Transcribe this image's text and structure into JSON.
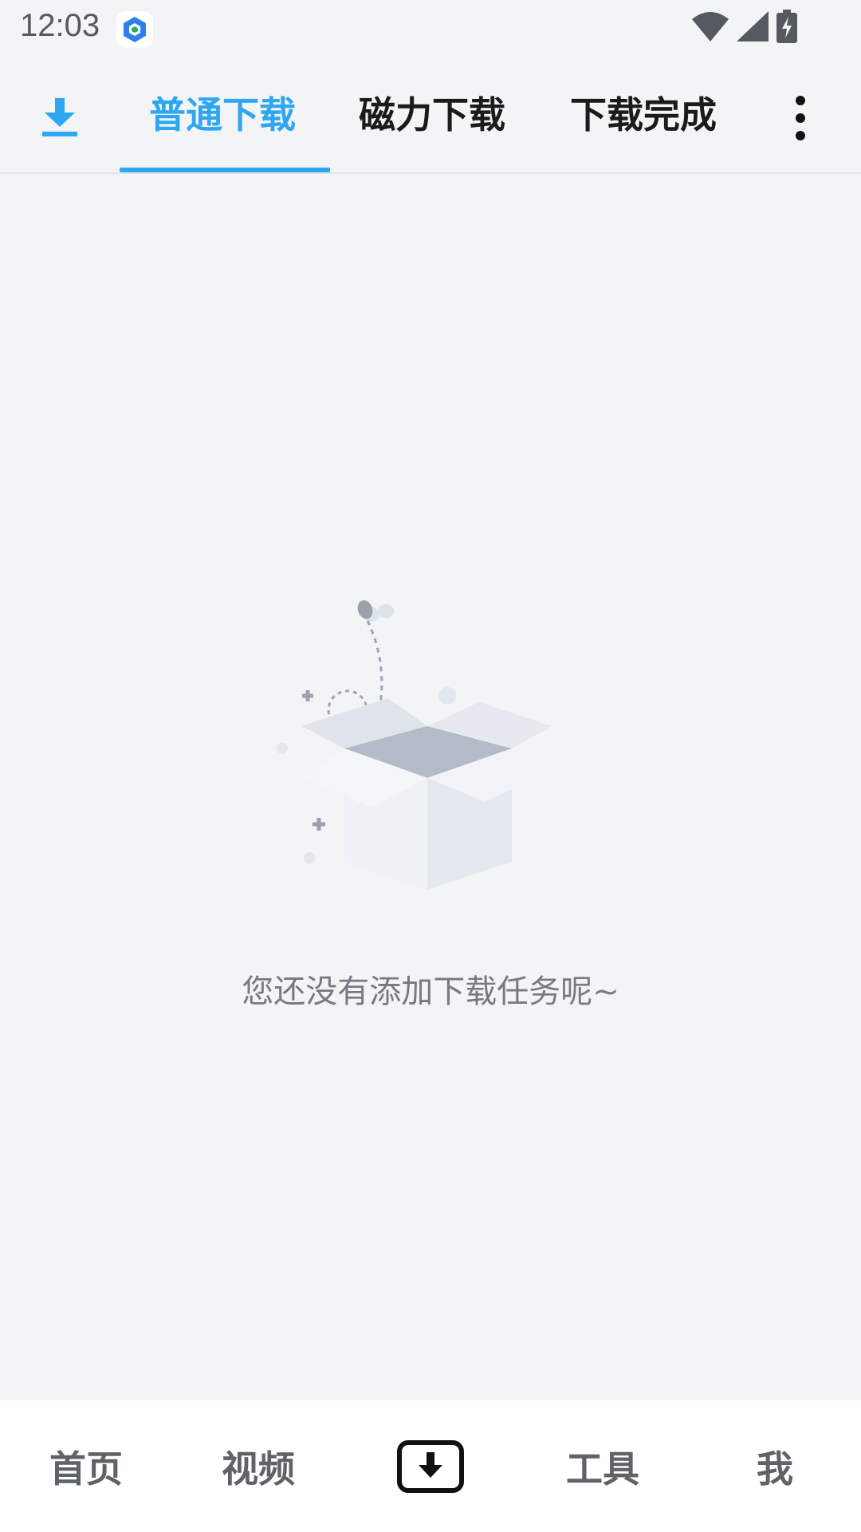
{
  "status_bar": {
    "time": "12:03",
    "icons": [
      "app-notification-icon",
      "wifi-icon",
      "cellular-signal-icon",
      "battery-charging-icon"
    ]
  },
  "top_bar": {
    "download_icon": "download-icon",
    "tabs": [
      {
        "label": "普通下载",
        "active": true
      },
      {
        "label": "磁力下载",
        "active": false
      },
      {
        "label": "下载完成",
        "active": false
      }
    ],
    "more_icon": "more-vertical-icon"
  },
  "empty_state": {
    "illustration": "empty-box-icon",
    "message": "您还没有添加下载任务呢~"
  },
  "bottom_nav": {
    "items": [
      {
        "label": "首页"
      },
      {
        "label": "视频"
      },
      {
        "label": "",
        "icon": "download-box-icon",
        "active": true
      },
      {
        "label": "工具"
      },
      {
        "label": "我"
      }
    ]
  },
  "colors": {
    "accent": "#2ea7f2",
    "background": "#f3f4f6",
    "nav_background": "#ffffff",
    "tab_text": "#1b1b1b",
    "nav_text": "#5f6266",
    "message_text": "#757b82"
  }
}
